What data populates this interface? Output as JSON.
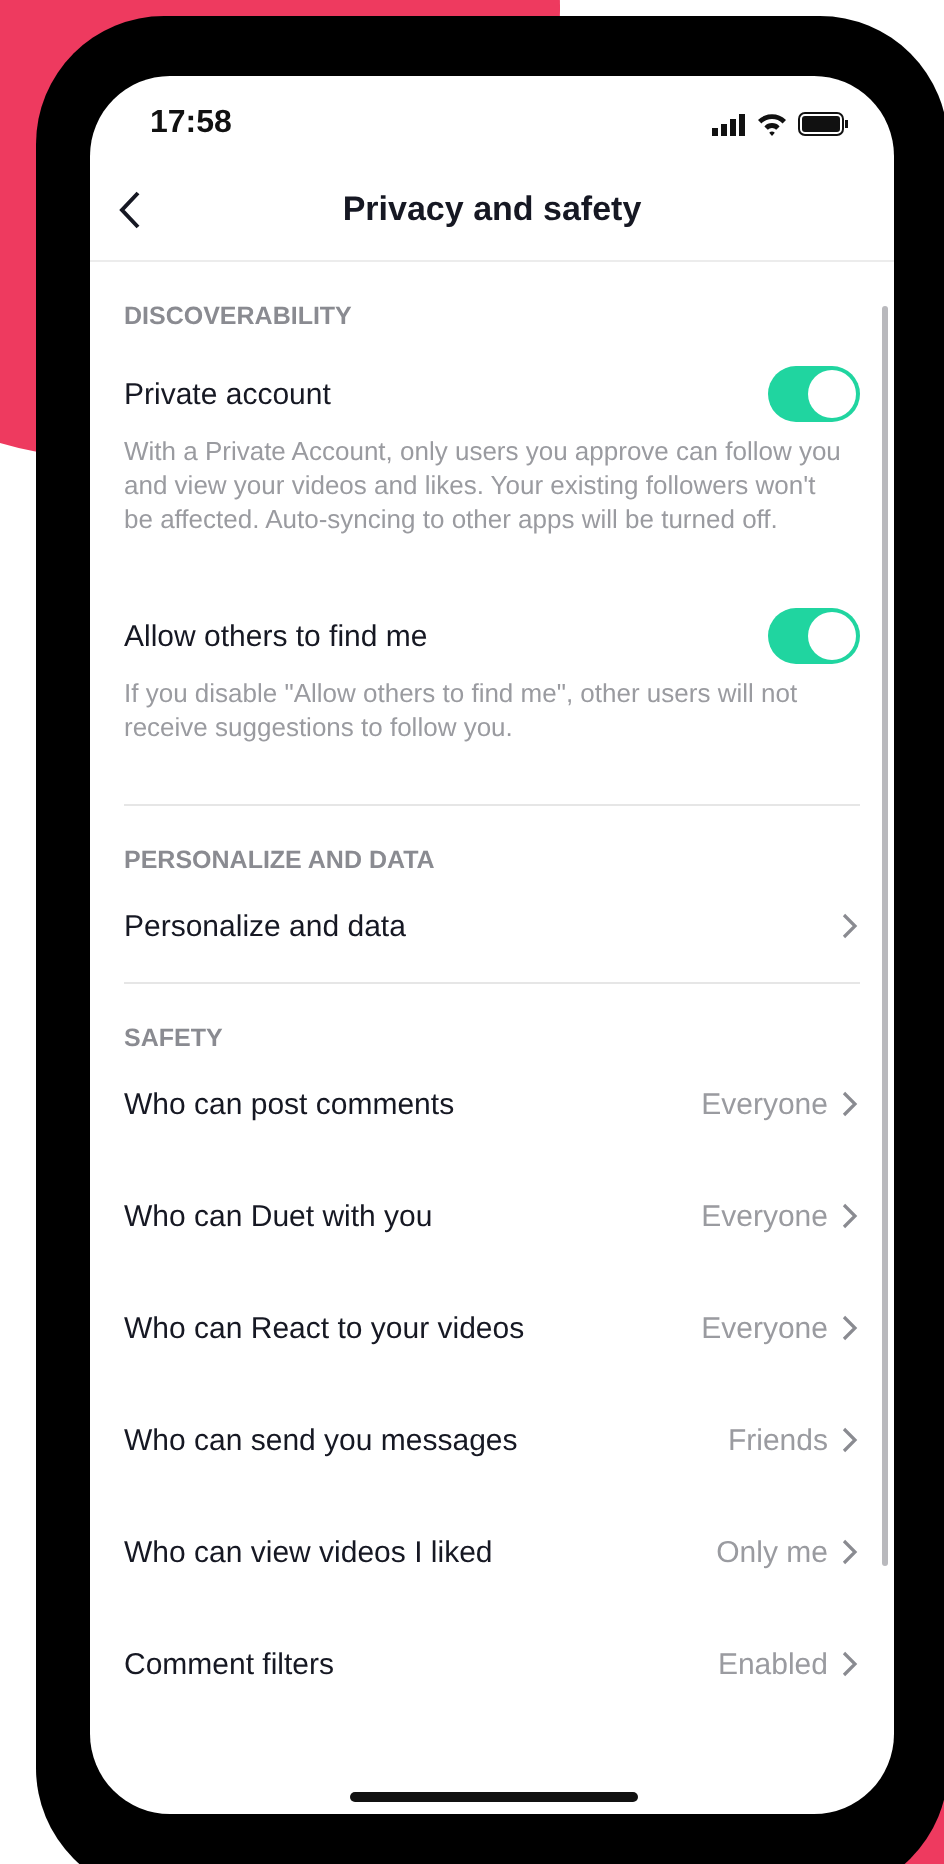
{
  "status_bar": {
    "time": "17:58"
  },
  "header": {
    "title": "Privacy and safety"
  },
  "sections": [
    {
      "heading": "DISCOVERABILITY",
      "items": [
        {
          "kind": "toggle",
          "label": "Private account",
          "on": true,
          "description": "With a Private Account, only users you approve can follow you and view your videos and likes. Your existing followers won't be affected. Auto-syncing to other apps will be turned off."
        },
        {
          "kind": "toggle",
          "label": "Allow others to find me",
          "on": true,
          "description": "If you disable \"Allow others to find me\", other users will not receive suggestions to follow you."
        }
      ]
    },
    {
      "heading": "PERSONALIZE AND DATA",
      "items": [
        {
          "kind": "link",
          "label": "Personalize and data"
        }
      ]
    },
    {
      "heading": "SAFETY",
      "items": [
        {
          "kind": "link",
          "label": "Who can post comments",
          "value": "Everyone"
        },
        {
          "kind": "link",
          "label": "Who can Duet with you",
          "value": "Everyone"
        },
        {
          "kind": "link",
          "label": "Who can React to your videos",
          "value": "Everyone"
        },
        {
          "kind": "link",
          "label": "Who can send you messages",
          "value": "Friends"
        },
        {
          "kind": "link",
          "label": "Who can view videos I liked",
          "value": "Only me"
        },
        {
          "kind": "link",
          "label": "Comment filters",
          "value": "Enabled"
        }
      ]
    }
  ]
}
